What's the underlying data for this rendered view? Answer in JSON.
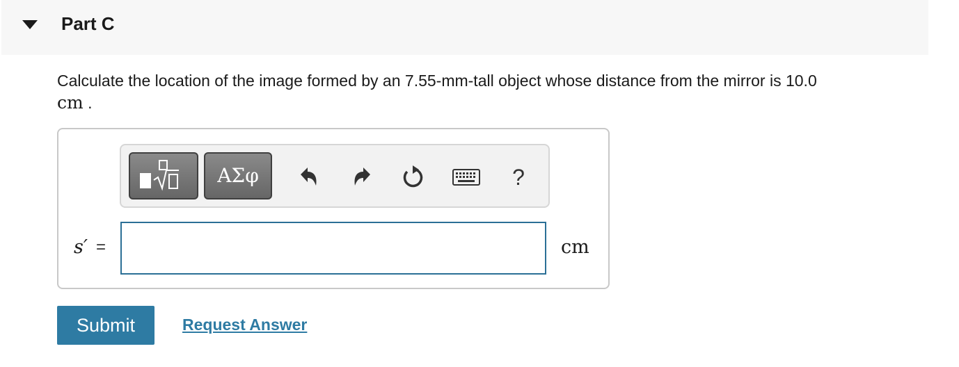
{
  "part": {
    "title": "Part C",
    "toggle_icon": "caret-down-icon"
  },
  "question": {
    "text": "Calculate the location of the image formed by an 7.55-mm-tall object whose distance from the mirror is 10.0",
    "unit": "cm",
    "end_punct": " ."
  },
  "toolbar": {
    "templates_icon": "templates-fraction-sqrt-icon",
    "symbols_label": "ΑΣφ",
    "undo_icon": "undo-icon",
    "redo_icon": "redo-icon",
    "reset_icon": "reset-icon",
    "keyboard_icon": "keyboard-icon",
    "help_label": "?"
  },
  "answer": {
    "variable": "s′",
    "equals": "=",
    "value": "",
    "placeholder": "",
    "unit": "cm"
  },
  "actions": {
    "submit_label": "Submit",
    "request_label": "Request Answer"
  },
  "colors": {
    "accent": "#2e7ba3",
    "header_bg": "#f7f7f7",
    "toolbar_bg": "#f2f2f2",
    "input_border": "#2b6f96"
  }
}
